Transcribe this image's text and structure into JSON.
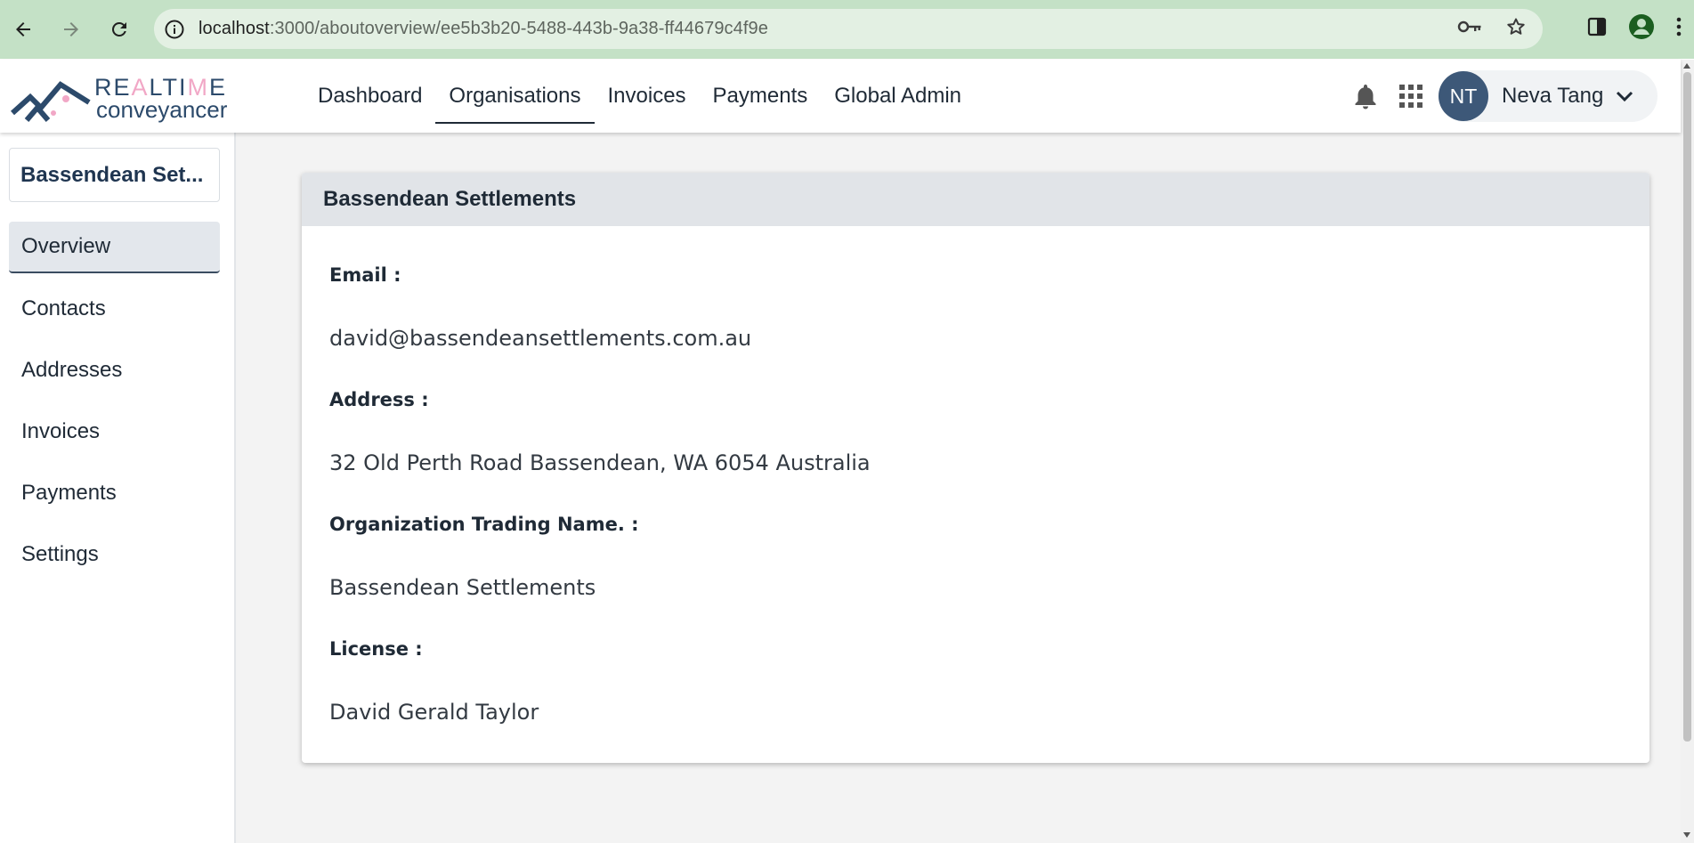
{
  "browser": {
    "url_host": "localhost",
    "url_path": ":3000/aboutoverview/ee5b3b20-5488-443b-9a38-ff44679c4f9e"
  },
  "header": {
    "logo_word1_a": "RE",
    "logo_word1_b": "A",
    "logo_word1_c": "LTI",
    "logo_word1_d": "M",
    "logo_word1_e": "E",
    "logo_word2": "conveyancer",
    "nav": [
      {
        "label": "Dashboard"
      },
      {
        "label": "Organisations"
      },
      {
        "label": "Invoices"
      },
      {
        "label": "Payments"
      },
      {
        "label": "Global Admin"
      }
    ],
    "user_initials": "NT",
    "user_name": "Neva Tang"
  },
  "sidebar": {
    "org_name": "Bassendean Set...",
    "items": [
      {
        "label": "Overview"
      },
      {
        "label": "Contacts"
      },
      {
        "label": "Addresses"
      },
      {
        "label": "Invoices"
      },
      {
        "label": "Payments"
      },
      {
        "label": "Settings"
      }
    ]
  },
  "card": {
    "title": "Bassendean Settlements",
    "fields": [
      {
        "label": "Email :",
        "value": "david@bassendeansettlements.com.au"
      },
      {
        "label": "Address :",
        "value": "32 Old Perth Road Bassendean, WA 6054 Australia"
      },
      {
        "label": "Organization Trading Name. :",
        "value": "Bassendean Settlements"
      },
      {
        "label": "License :",
        "value": "David Gerald Taylor"
      }
    ]
  },
  "colors": {
    "chrome_bg": "#c4e1c6",
    "brand_navy": "#2c4a6b",
    "brand_pink": "#f1a7c6",
    "avatar_bg": "#3d5878"
  }
}
